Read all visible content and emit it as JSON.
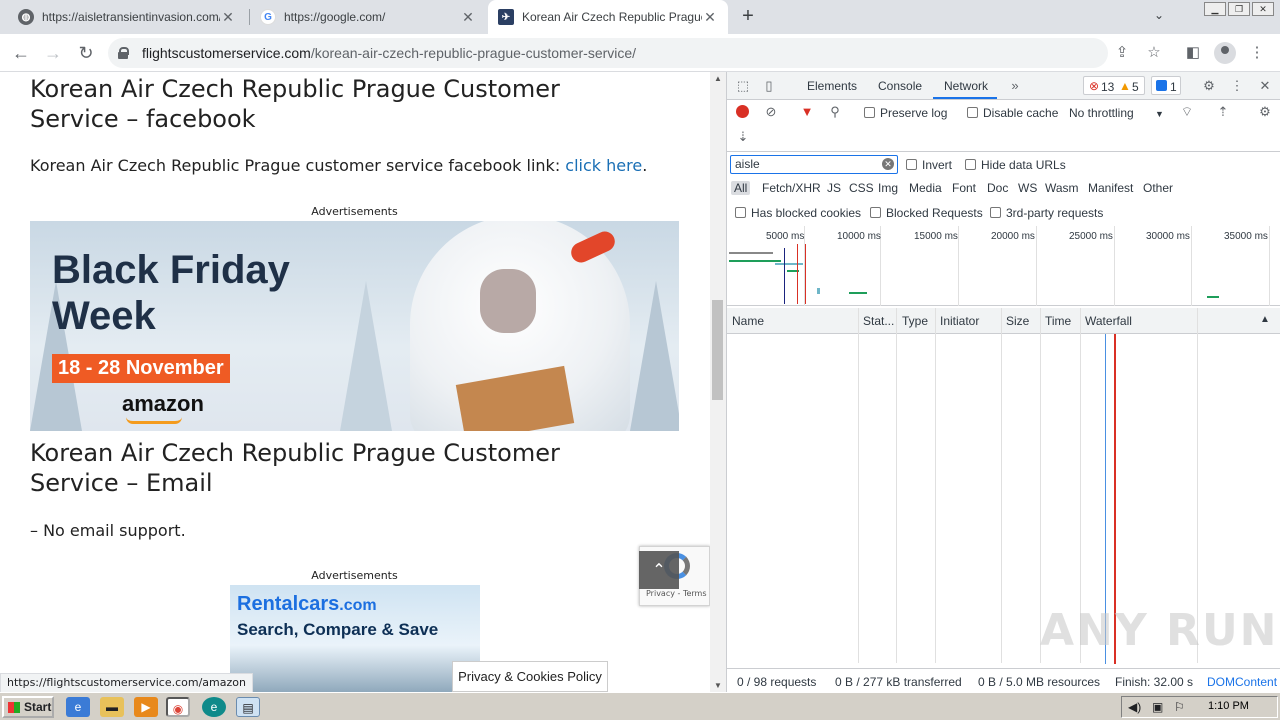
{
  "browser": {
    "tabs": [
      {
        "title": "https://aisletransientinvasion.com/d",
        "active": false
      },
      {
        "title": "https://google.com/",
        "active": false
      },
      {
        "title": "Korean Air Czech Republic Prague C",
        "active": true
      }
    ],
    "url_host": "flightscustomerservice.com",
    "url_path": "/korean-air-czech-republic-prague-customer-service/"
  },
  "page": {
    "heading_facebook": "Korean Air Czech Republic Prague Customer Service – facebook",
    "facebook_text": "Korean Air Czech Republic Prague customer service facebook link: ",
    "facebook_link": "click here",
    "facebook_period": ".",
    "ad_label_1": "Advertisements",
    "ad1_line1": "Black Friday",
    "ad1_line2": "Week",
    "ad1_date": "18 - 28 November",
    "ad1_brand": "amazon",
    "heading_email": "Korean Air Czech Republic Prague Customer Service – Email",
    "email_text": "– No email support.",
    "ad_label_2": "Advertisements",
    "ad2_brand": "Rentalcars",
    "ad2_brand_suffix": ".com",
    "ad2_tagline": "Search, Compare & Save",
    "recaptcha_text": "Privacy - Terms",
    "privacy_button": "Privacy & Cookies Policy",
    "status_url": "https://flightscustomerservice.com/amazon"
  },
  "devtools": {
    "tabs": [
      "Elements",
      "Console",
      "Network"
    ],
    "active_tab": "Network",
    "error_count": "13",
    "warning_count": "5",
    "message_count": "1",
    "preserve_log": "Preserve log",
    "disable_cache": "Disable cache",
    "throttling": "No throttling",
    "filter_value": "aisle",
    "invert": "Invert",
    "hide_data_urls": "Hide data URLs",
    "type_filters": [
      "All",
      "Fetch/XHR",
      "JS",
      "CSS",
      "Img",
      "Media",
      "Font",
      "Doc",
      "WS",
      "Wasm",
      "Manifest",
      "Other"
    ],
    "has_blocked_cookies": "Has blocked cookies",
    "blocked_requests": "Blocked Requests",
    "third_party": "3rd-party requests",
    "timeline_ticks": [
      "5000 ms",
      "10000 ms",
      "15000 ms",
      "20000 ms",
      "25000 ms",
      "30000 ms",
      "35000 ms"
    ],
    "columns": [
      "Name",
      "Stat...",
      "Type",
      "Initiator",
      "Size",
      "Time",
      "Waterfall"
    ],
    "status_requests": "0 / 98 requests",
    "status_transferred": "0 B / 277 kB transferred",
    "status_resources": "0 B / 5.0 MB resources",
    "status_finish": "Finish: 32.00 s",
    "status_domcontent": "DOMContent"
  },
  "taskbar": {
    "start": "Start",
    "clock": "1:10 PM"
  },
  "watermark": "ANY RUN",
  "colors": {
    "link": "#1a6fb5",
    "accent_blue": "#1a73e8",
    "record_red": "#d93025",
    "ad_orange": "#ef5b24"
  }
}
